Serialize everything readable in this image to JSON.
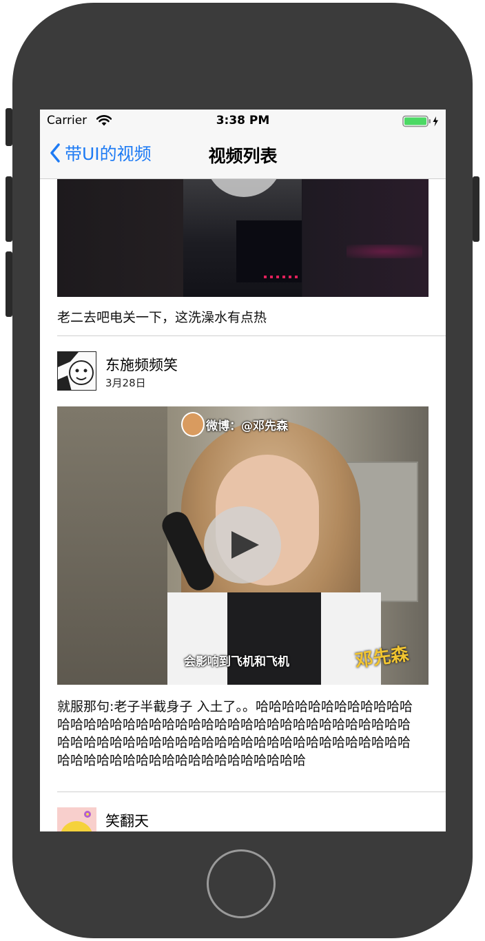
{
  "status_bar": {
    "carrier": "Carrier",
    "time": "3:38 PM"
  },
  "nav": {
    "back_label": "带UI的视频",
    "title": "视频列表"
  },
  "feed": {
    "items": [
      {
        "caption": "老二去吧电关一下，这洗澡水有点热"
      },
      {
        "username": "东施频频笑",
        "date": "3月28日",
        "video_overlay_top": "微博：@邓先森",
        "video_overlay_subtitle": "会影响到飞机和飞机",
        "video_overlay_logo": "邓先森",
        "caption": "就服那句:老子半截身子 入土了。。哈哈哈哈哈哈哈哈哈哈哈哈哈哈哈哈哈哈哈哈哈哈哈哈哈哈哈哈哈哈哈哈哈哈哈哈哈哈哈哈哈哈哈哈哈哈哈哈哈哈哈哈哈哈哈哈哈哈哈哈哈哈哈哈哈哈哈哈哈哈哈哈哈哈哈哈哈哈哈哈哈哈哈哈哈"
      },
      {
        "username": "笑翻天"
      }
    ]
  },
  "colors": {
    "accent": "#1e7bf4",
    "battery": "#4cd964",
    "device_body": "#3b3b3b"
  }
}
